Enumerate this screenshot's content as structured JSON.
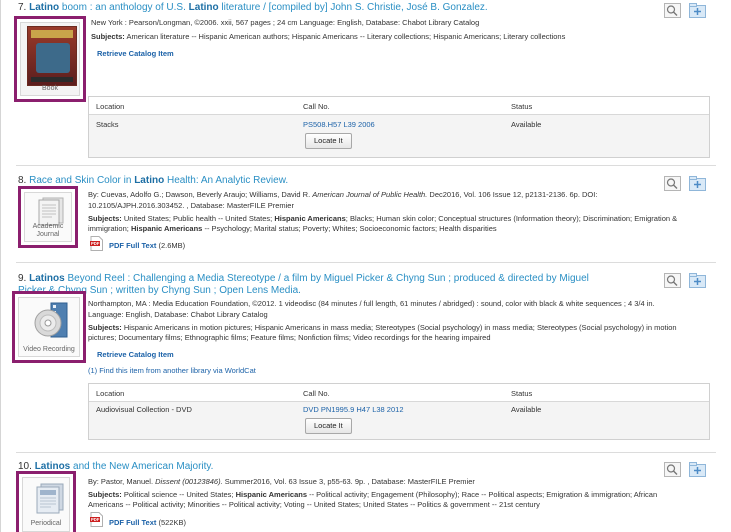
{
  "records": [
    {
      "number": "7.",
      "title_parts": [
        {
          "text": "Latino",
          "bold": true
        },
        {
          "text": " boom : an anthology of U.S. ",
          "bold": false
        },
        {
          "text": "Latino",
          "bold": true
        },
        {
          "text": " literature / [compiled by] John S. Christie, José B. Gonzalez.",
          "bold": false
        }
      ],
      "format": "Book",
      "meta": "New York : Pearson/Longman, ©2006. xxii, 567 pages ; 24 cm Language: English, Database: Chabot Library Catalog",
      "subjects_label": "Subjects:",
      "subjects": "American literature -- Hispanic American authors; Hispanic Americans -- Literary collections; Hispanic Americans; Literary collections",
      "action": "Retrieve Catalog Item",
      "holdings": {
        "headers": [
          "Location",
          "Call No.",
          "Status"
        ],
        "location": "Stacks",
        "call_no": "PS508.H57 L39 2006",
        "status": "Available",
        "button": "Locate It"
      }
    },
    {
      "number": "8.",
      "title_parts": [
        {
          "text": "Race and Skin Color in ",
          "bold": false
        },
        {
          "text": "Latino",
          "bold": true
        },
        {
          "text": " Health: An Analytic Review.",
          "bold": false
        }
      ],
      "format": "Academic Journal",
      "meta_line1_pre": "By: Cuevas, Adolfo G.; Dawson, Beverly Araujo; Williams, David R. ",
      "meta_line1_journal": "American Journal of Public Health.",
      "meta_line1_post": " Dec2016, Vol. 106 Issue 12, p2131-2136. 6p. DOI:",
      "meta_line2": "10.2105/AJPH.2016.303452. , Database: MasterFILE Premier",
      "subjects_label": "Subjects:",
      "subjects_line1_pre": "United States; Public health -- United States; ",
      "subjects_line1_bold": "Hispanic Americans",
      "subjects_line1_post": "; Blacks; Human skin color; Conceptual structures (Information theory); Discrimination; Emigration &",
      "subjects_line2_pre": "immigration; ",
      "subjects_line2_bold": "Hispanic Americans",
      "subjects_line2_post": " -- Psychology; Marital status; Poverty; Whites; Socioeconomic factors; Health disparities",
      "action": "PDF Full Text",
      "size": "(2.6MB)"
    },
    {
      "number": "9.",
      "title_line1_bold": "Latinos",
      "title_line1": " Beyond Reel : Challenging a Media Stereotype / a film by Miguel Picker & Chyng Sun ; produced & directed by Miguel",
      "title_line2": "Picker & Chyng Sun ; written by Chyng Sun ; Open Lens Media.",
      "format": "Video Recording",
      "meta_line1": "Northampton, MA : Media Education Foundation, ©2012. 1 videodisc (84 minutes / full length, 61 minutes / abridged) : sound, color with black & white sequences ; 4 3/4 in.",
      "meta_line2": "Language: English, Database: Chabot Library Catalog",
      "subjects_label": "Subjects:",
      "subjects_line1": "Hispanic Americans in motion pictures; Hispanic Americans in mass media; Stereotypes (Social psychology) in mass media; Stereotypes (Social psychology) in motion",
      "subjects_line2": "pictures; Documentary films; Ethnographic films; Feature films; Nonfiction films; Video recordings for the hearing impaired",
      "action": "Retrieve Catalog Item",
      "worldcat": "(1) Find this item from another library via WorldCat",
      "holdings": {
        "headers": [
          "Location",
          "Call No.",
          "Status"
        ],
        "location": "Audiovisual Collection - DVD",
        "call_no": "DVD PN1995.9 H47 L38 2012",
        "status": "Available",
        "button": "Locate It"
      }
    },
    {
      "number": "10.",
      "title_bold": "Latinos",
      "title_rest": " and the New American Majority.",
      "format": "Periodical",
      "meta_pre": "By: Pastor, Manuel. ",
      "meta_journal": "Dissent (00123846).",
      "meta_post": " Summer2016, Vol. 63 Issue 3, p55-63. 9p. , Database: MasterFILE Premier",
      "subjects_label": "Subjects:",
      "subjects_line1_pre": "Political science -- United States; ",
      "subjects_line1_bold": "Hispanic Americans",
      "subjects_line1_post": " -- Political activity; Engagement (Philosophy); Race -- Political aspects; Emigration & immigration; African",
      "subjects_line2": "Americans -- Political activity; Minorities -- Political activity; Voting -- United States; United States -- Politics & government -- 21st century",
      "action": "PDF Full Text",
      "size": "(522KB)"
    }
  ],
  "icons": {
    "preview": "magnifier-preview-icon",
    "add_folder": "add-to-folder-icon",
    "pdf": "pdf-icon"
  },
  "colors": {
    "thumbnail_border": "#8b1f6e",
    "link": "#1c62a8",
    "title": "#2a8fc4"
  }
}
